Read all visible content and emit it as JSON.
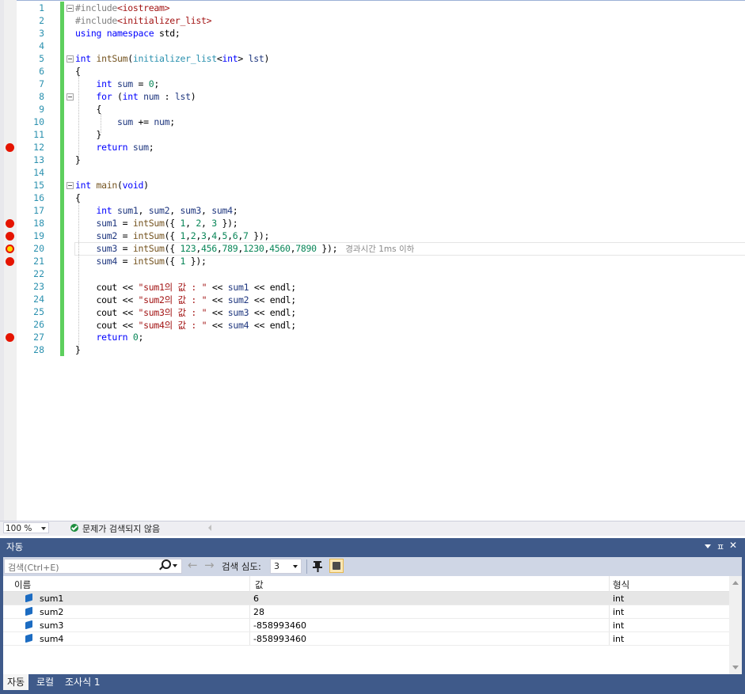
{
  "editor": {
    "lines": [
      {
        "n": "1",
        "code": "#include<iostream>",
        "fold": true
      },
      {
        "n": "2",
        "code": "#include<initializer_list>"
      },
      {
        "n": "3",
        "code": "using namespace std;"
      },
      {
        "n": "4",
        "code": ""
      },
      {
        "n": "5",
        "code": "int intSum(initializer_list<int> lst)",
        "fold": true
      },
      {
        "n": "6",
        "code": "{"
      },
      {
        "n": "7",
        "code": "    int sum = 0;"
      },
      {
        "n": "8",
        "code": "    for (int num : lst)",
        "fold": true
      },
      {
        "n": "9",
        "code": "    {"
      },
      {
        "n": "10",
        "code": "        sum += num;"
      },
      {
        "n": "11",
        "code": "    }"
      },
      {
        "n": "12",
        "code": "    return sum;",
        "breakpoint": true
      },
      {
        "n": "13",
        "code": "}"
      },
      {
        "n": "14",
        "code": ""
      },
      {
        "n": "15",
        "code": "int main(void)",
        "fold": true
      },
      {
        "n": "16",
        "code": "{"
      },
      {
        "n": "17",
        "code": "    int sum1, sum2, sum3, sum4;"
      },
      {
        "n": "18",
        "code": "    sum1 = intSum({ 1, 2, 3 });",
        "breakpoint": true
      },
      {
        "n": "19",
        "code": "    sum2 = intSum({ 1,2,3,4,5,6,7 });",
        "breakpoint": true
      },
      {
        "n": "20",
        "code": "    sum3 = intSum({ 123,456,789,1230,4560,7890 });",
        "current": true,
        "hint": "경과시간 1ms 이하"
      },
      {
        "n": "21",
        "code": "    sum4 = intSum({ 1 });",
        "breakpoint": true
      },
      {
        "n": "22",
        "code": ""
      },
      {
        "n": "23",
        "code": "    cout << \"sum1의 값 : \" << sum1 << endl;"
      },
      {
        "n": "24",
        "code": "    cout << \"sum2의 값 : \" << sum2 << endl;"
      },
      {
        "n": "25",
        "code": "    cout << \"sum3의 값 : \" << sum3 << endl;"
      },
      {
        "n": "26",
        "code": "    cout << \"sum4의 값 : \" << sum4 << endl;"
      },
      {
        "n": "27",
        "code": "    return 0;",
        "breakpoint": true
      },
      {
        "n": "28",
        "code": "}"
      }
    ]
  },
  "status": {
    "zoom": "100 %",
    "issues": "문제가 검색되지 않음"
  },
  "autos": {
    "title": "자동",
    "pin": "ㅍ",
    "close": "✕",
    "search_placeholder": "검색(Ctrl+E)",
    "back": "←",
    "forward": "→",
    "depth_label": "검색 심도:",
    "depth_value": "3",
    "columns": {
      "name": "이름",
      "value": "값",
      "type": "형식"
    },
    "rows": [
      {
        "name": "sum1",
        "value": "6",
        "type": "int"
      },
      {
        "name": "sum2",
        "value": "28",
        "type": "int"
      },
      {
        "name": "sum3",
        "value": "-858993460",
        "type": "int"
      },
      {
        "name": "sum4",
        "value": "-858993460",
        "type": "int"
      }
    ],
    "tabs": [
      "자동",
      "로컬",
      "조사식 1"
    ]
  },
  "colors": {
    "keyword": "#0000ff",
    "string": "#a31515",
    "identifier": "#1f377f",
    "function": "#74531f",
    "number": "#098658",
    "preprocessor": "#808080",
    "type": "#2b91af",
    "panel": "#3f5a8a",
    "breakpoint": "#e51400"
  }
}
